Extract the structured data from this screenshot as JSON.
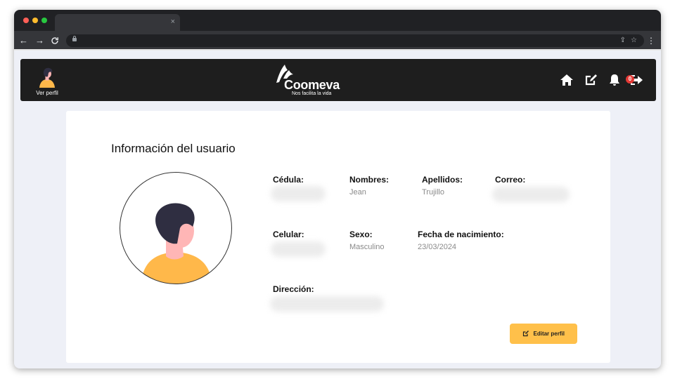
{
  "browser": {
    "tab_close": "×",
    "nav": {
      "back": "←",
      "forward": "→",
      "reload": "C"
    },
    "omnibox_icons": {
      "share": "⇪",
      "star": "☆"
    },
    "menu": "⋮"
  },
  "header": {
    "profile_label": "Ver perfil",
    "logo": {
      "brand": "Coomeva",
      "tagline": "Nos facilita la vida"
    },
    "notifications_count": "0",
    "icons": [
      "home-icon",
      "edit-icon",
      "bell-icon",
      "logout-icon"
    ]
  },
  "card": {
    "title": "Información del usuario",
    "fields": {
      "cedula": {
        "label": "Cédula:",
        "value": ""
      },
      "nombres": {
        "label": "Nombres:",
        "value": "Jean"
      },
      "apellidos": {
        "label": "Apellidos:",
        "value": "Trujillo"
      },
      "correo": {
        "label": "Correo:",
        "value": ""
      },
      "celular": {
        "label": "Celular:",
        "value": ""
      },
      "sexo": {
        "label": "Sexo:",
        "value": "Masculino"
      },
      "fecha_nacimiento": {
        "label": "Fecha de nacimiento:",
        "value": "23/03/2024"
      },
      "direccion": {
        "label": "Dirección:",
        "value": ""
      }
    },
    "edit_button_label": "Editar perfil"
  },
  "colors": {
    "appbar": "#1e1e1e",
    "page_background": "#eef0f7",
    "button": "#ffc04a",
    "badge": "#e53935",
    "avatar_shirt": "#ffb84a",
    "avatar_hair": "#2f2e41",
    "avatar_skin": "#ffb6b6"
  }
}
